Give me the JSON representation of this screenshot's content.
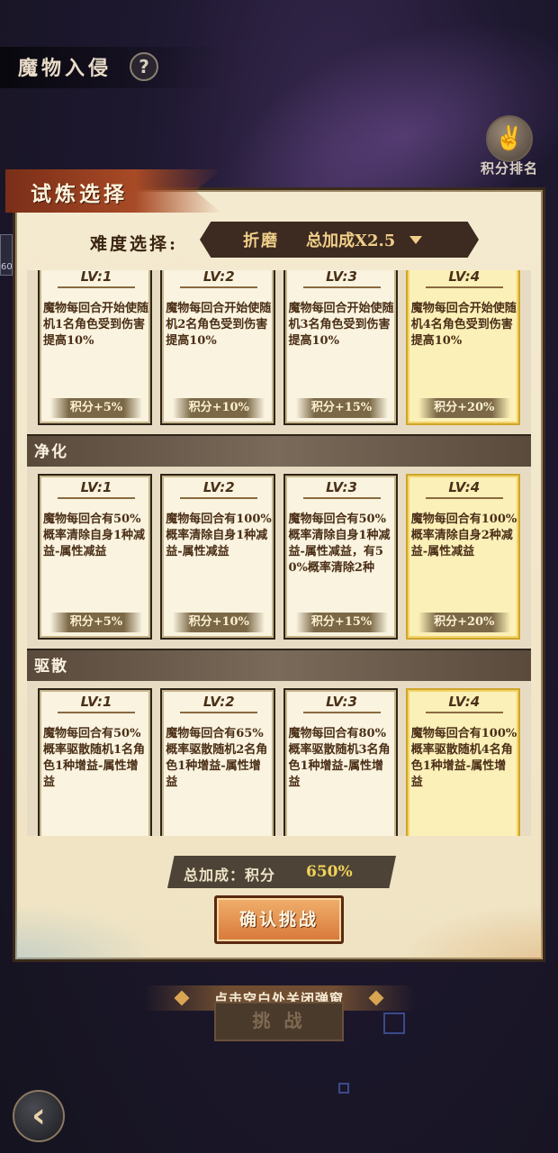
{
  "header": {
    "title": "魔物入侵",
    "help_icon": "?",
    "rank_label": "积分排名"
  },
  "dialog": {
    "title": "试炼选择",
    "difficulty_label": "难度选择:",
    "difficulty_level": "折磨",
    "difficulty_bonus": "总加成X2.5",
    "sections": [
      {
        "name": "",
        "cards": [
          {
            "lv": "LV:1",
            "text": "魔物每回合开始使随机1名角色受到伤害提高10%",
            "score": "积分+5%"
          },
          {
            "lv": "LV:2",
            "text": "魔物每回合开始使随机2名角色受到伤害提高10%",
            "score": "积分+10%"
          },
          {
            "lv": "LV:3",
            "text": "魔物每回合开始使随机3名角色受到伤害提高10%",
            "score": "积分+15%"
          },
          {
            "lv": "LV:4",
            "text": "魔物每回合开始使随机4名角色受到伤害提高10%",
            "score": "积分+20%"
          }
        ]
      },
      {
        "name": "净化",
        "cards": [
          {
            "lv": "LV:1",
            "text": "魔物每回合有50%概率清除自身1种减益-属性减益",
            "score": "积分+5%"
          },
          {
            "lv": "LV:2",
            "text": "魔物每回合有100%概率清除自身1种减益-属性减益",
            "score": "积分+10%"
          },
          {
            "lv": "LV:3",
            "text": "魔物每回合有50%概率清除自身1种减益-属性减益，有50%概率清除2种",
            "score": "积分+15%"
          },
          {
            "lv": "LV:4",
            "text": "魔物每回合有100%概率清除自身2种减益-属性减益",
            "score": "积分+20%"
          }
        ]
      },
      {
        "name": "驱散",
        "cards": [
          {
            "lv": "LV:1",
            "text": "魔物每回合有50%概率驱散随机1名角色1种增益-属性增益",
            "score": ""
          },
          {
            "lv": "LV:2",
            "text": "魔物每回合有65%概率驱散随机2名角色1种增益-属性增益",
            "score": ""
          },
          {
            "lv": "LV:3",
            "text": "魔物每回合有80%概率驱散随机3名角色1种增益-属性增益",
            "score": ""
          },
          {
            "lv": "LV:4",
            "text": "魔物每回合有100%概率驱散随机4名角色1种增益-属性增益",
            "score": ""
          }
        ]
      }
    ],
    "total_label": "总加成：积分",
    "total_value": "650%",
    "confirm_label": "确认挑战"
  },
  "footer": {
    "close_hint": "点击空白处关闭弹窗",
    "bg_button": "挑 战",
    "back_icon": "‹"
  }
}
